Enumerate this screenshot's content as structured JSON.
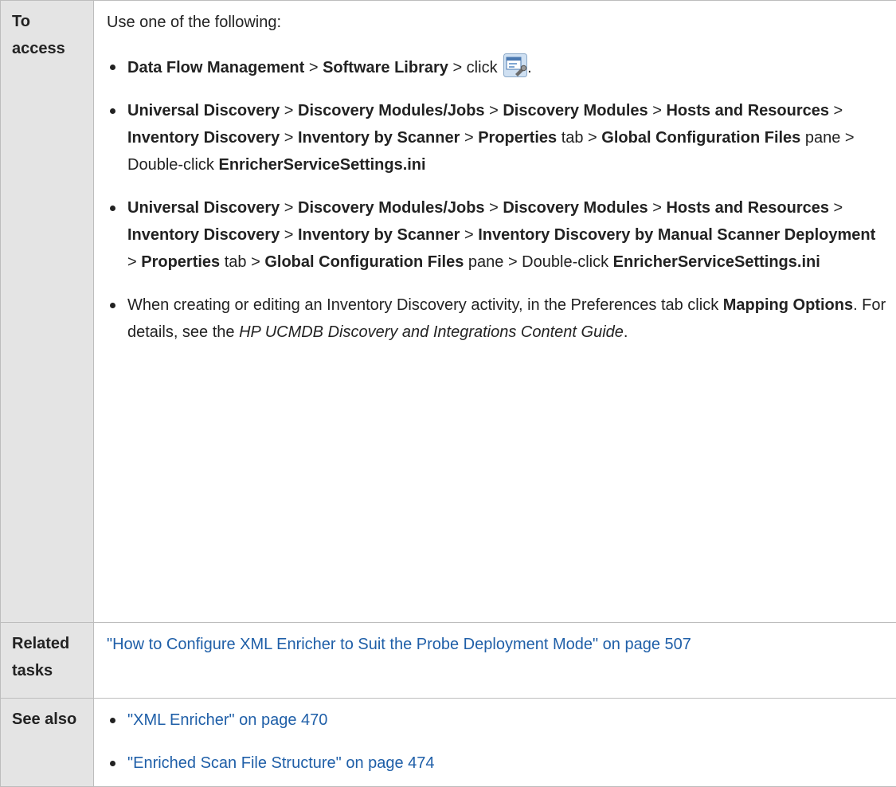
{
  "access": {
    "label": "To access",
    "intro": "Use one of the following:",
    "item1": {
      "p1": "Data Flow Management",
      "s1": " > ",
      "p2": "Software Library",
      "s2": " > click ",
      "s3": ".",
      "icon": "software-library-icon"
    },
    "item2": {
      "p1": "Universal Discovery",
      "s1": " > ",
      "p2": "Discovery Modules/Jobs",
      "s2": " > ",
      "p3": "Discovery Modules",
      "s3": "  > ",
      "p4": "Hosts and Resources",
      "s4": " > ",
      "p5": "Inventory Discovery",
      "s5": " > ",
      "p6": "Inventory by Scanner",
      "s6": " > ",
      "p7": "Properties",
      "s7": " tab > ",
      "p8": "Global Configuration Files",
      "s8": " pane > Double-click ",
      "p9": "EnricherServiceSettings.ini"
    },
    "item3": {
      "p1": "Universal Discovery",
      "s1": " > ",
      "p2": "Discovery Modules/Jobs",
      "s2": " > ",
      "p3": "Discovery Modules",
      "s3": "  > ",
      "p4": "Hosts and Resources",
      "s4": " > ",
      "p5": "Inventory Discovery",
      "s5": " > ",
      "p6": "Inventory by Scanner",
      "s6": " > ",
      "p7": "Inventory Discovery by Manual Scanner Deployment",
      "s7": " > ",
      "p8": "Properties",
      "s8": " tab > ",
      "p9": "Global Configuration Files",
      "s9": " pane > Double-click ",
      "p10": "EnricherServiceSettings.ini"
    },
    "item4": {
      "t1": "When creating or editing an Inventory Discovery activity, in the Preferences tab click ",
      "b1": "Mapping Options",
      "t2": ". For details, see the ",
      "i1": "HP UCMDB Discovery and Integrations Content Guide",
      "t3": "."
    }
  },
  "related": {
    "label": "Related tasks",
    "link": "\"How to Configure XML Enricher to Suit the Probe Deployment Mode\" on page 507"
  },
  "see_also": {
    "label": "See also",
    "link1": "\"XML Enricher\" on page 470",
    "link2": "\"Enriched Scan File Structure\" on page 474"
  },
  "colors": {
    "label_bg": "#e4e4e4",
    "border": "#bdbdbd",
    "link": "#1f5fa8"
  }
}
